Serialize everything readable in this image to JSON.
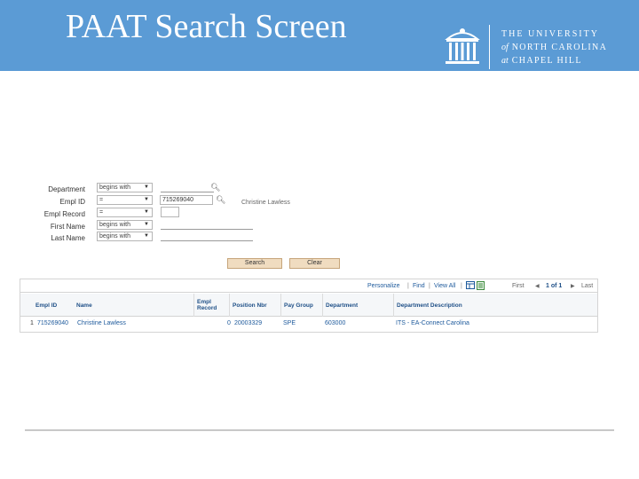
{
  "header": {
    "title": "PAAT Search Screen",
    "university_line1": "THE UNIVERSITY",
    "university_of": "of",
    "university_line2": "NORTH CAROLINA",
    "university_at": "at",
    "university_line3": "CHAPEL HILL",
    "banner_color": "#5b9bd5"
  },
  "form": {
    "department": {
      "label": "Department",
      "operator": "begins with",
      "value": ""
    },
    "empl_id": {
      "label": "Empl ID",
      "operator": "=",
      "value": "715269040",
      "name_display": "Christine Lawless"
    },
    "empl_record": {
      "label": "Empl Record",
      "operator": "=",
      "value": ""
    },
    "first_name": {
      "label": "First Name",
      "operator": "begins with",
      "value": ""
    },
    "last_name": {
      "label": "Last Name",
      "operator": "begins with",
      "value": ""
    }
  },
  "buttons": {
    "search": "Search",
    "clear": "Clear"
  },
  "grid": {
    "toolbar": {
      "personalize": "Personalize",
      "find": "Find",
      "view_all": "View All",
      "first": "First",
      "range": "1 of 1",
      "last": "Last"
    },
    "columns": {
      "empl_id": "Empl ID",
      "name": "Name",
      "empl_record": "Empl Record",
      "position_nbr": "Position Nbr",
      "pay_group": "Pay Group",
      "department": "Department",
      "department_description": "Department Description"
    },
    "rows": [
      {
        "index": "1",
        "empl_id": "715269040",
        "name": "Christine Lawless",
        "empl_record": "0",
        "position_nbr": "20003329",
        "pay_group": "SPE",
        "department": "603000",
        "department_description": "ITS - EA-Connect Carolina"
      }
    ]
  }
}
